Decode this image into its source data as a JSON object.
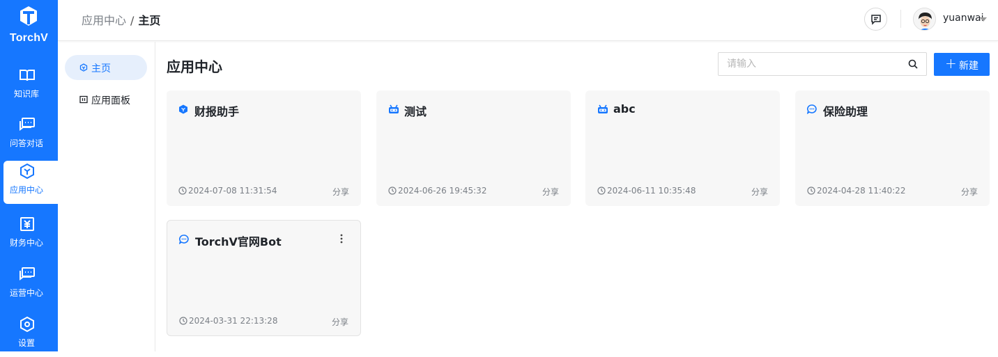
{
  "brand": {
    "name": "TorchV"
  },
  "rail": [
    {
      "label": "知识库",
      "icon": "book-icon"
    },
    {
      "label": "问答对话",
      "icon": "chat-icon"
    },
    {
      "label": "应用中心",
      "icon": "hexagon-icon",
      "active": true
    },
    {
      "label": "财务中心",
      "icon": "finance-icon"
    },
    {
      "label": "运营中心",
      "icon": "chat-icon"
    },
    {
      "label": "设置",
      "icon": "settings-icon"
    }
  ],
  "header": {
    "breadcrumb": [
      "应用中心",
      "/",
      "主页"
    ],
    "username": "yuanwai"
  },
  "subnav": [
    {
      "label": "主页",
      "active": true
    },
    {
      "label": "应用面板",
      "active": false
    }
  ],
  "main": {
    "title": "应用中心",
    "search_placeholder": "请输入",
    "new_button": "新建",
    "plus_icon": "+",
    "cards": [
      {
        "name": "财报助手",
        "icon": "hexagon-icon",
        "time": "2024-07-08 11:31:54",
        "share": "分享"
      },
      {
        "name": "测试",
        "icon": "robot-icon",
        "time": "2024-06-26 19:45:32",
        "share": "分享"
      },
      {
        "name": "abc",
        "icon": "robot-icon",
        "time": "2024-06-11 10:35:48",
        "share": "分享"
      },
      {
        "name": "保险助理",
        "icon": "chat-bubble-icon",
        "time": "2024-04-28 11:40:22",
        "share": "分享"
      },
      {
        "name": "TorchV官网Bot",
        "icon": "chat-bubble-icon",
        "time": "2024-03-31 22:13:28",
        "share": "分享"
      }
    ]
  },
  "colors": {
    "primary": "#1677ff",
    "card_bg": "#f7f7f7"
  }
}
